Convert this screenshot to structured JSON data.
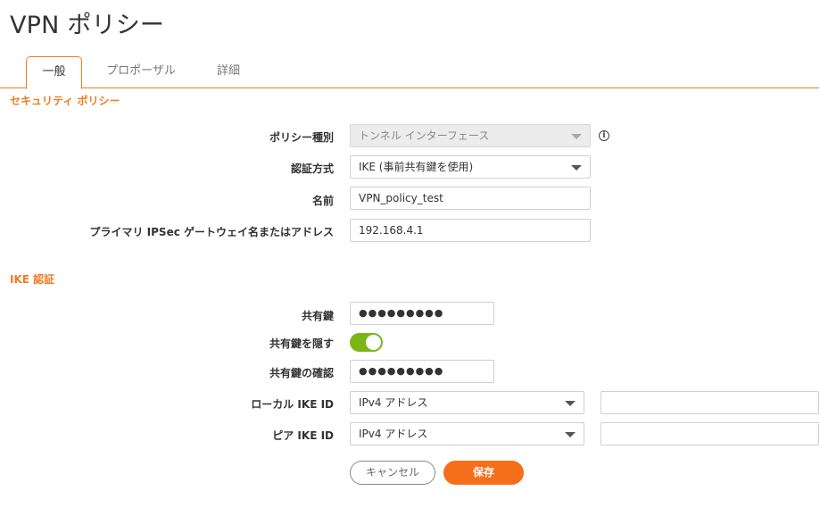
{
  "page": {
    "title": "VPN ポリシー"
  },
  "tabs": [
    {
      "label": "一般",
      "active": true
    },
    {
      "label": "プロポーザル",
      "active": false
    },
    {
      "label": "詳細",
      "active": false
    }
  ],
  "security_policy": {
    "section_title": "セキュリティ ポリシー",
    "policy_type": {
      "label": "ポリシー種別",
      "value": "トンネル インターフェース",
      "disabled": true
    },
    "auth_method": {
      "label": "認証方式",
      "value": "IKE (事前共有鍵を使用)"
    },
    "name": {
      "label": "名前",
      "value": "VPN_policy_test"
    },
    "primary_gateway": {
      "label": "プライマリ IPSec ゲートウェイ名またはアドレス",
      "value": "192.168.4.1"
    }
  },
  "ike_auth": {
    "section_title": "IKE 認証",
    "shared_secret": {
      "label": "共有鍵",
      "value": "●●●●●●●●●"
    },
    "hide_secret": {
      "label": "共有鍵を隠す",
      "on": true
    },
    "confirm_secret": {
      "label": "共有鍵の確認",
      "value": "●●●●●●●●●"
    },
    "local_ike_id": {
      "label": "ローカル IKE ID",
      "type": "IPv4 アドレス",
      "value": ""
    },
    "peer_ike_id": {
      "label": "ピア IKE ID",
      "type": "IPv4 アドレス",
      "value": ""
    }
  },
  "buttons": {
    "cancel": "キャンセル",
    "save": "保存"
  },
  "colors": {
    "accent": "#f07c21",
    "save": "#f56f1b",
    "toggle_on": "#7cb518"
  },
  "icons": {
    "info": "info-icon",
    "dropdown": "chevron-down-icon"
  }
}
